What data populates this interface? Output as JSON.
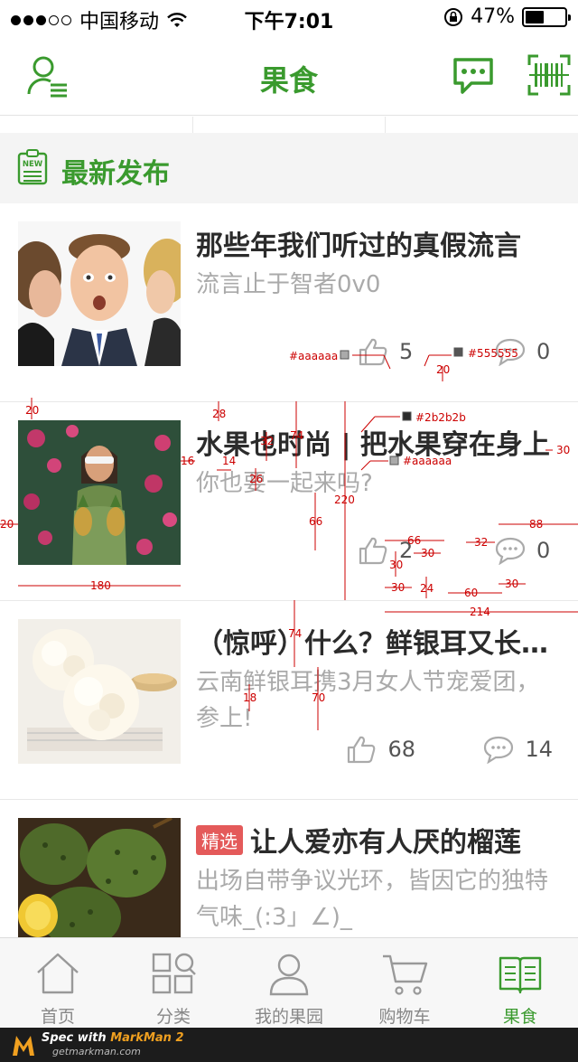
{
  "status_bar": {
    "carrier": "中国移动",
    "time": "下午7:01",
    "battery_text": "47%",
    "battery_level": 0.47
  },
  "nav": {
    "title": "果食",
    "left_icon": "user-list-icon",
    "right_icons": [
      "message-icon",
      "barcode-scan-icon"
    ]
  },
  "section": {
    "icon": "new-clipboard-icon",
    "badge_text": "NEW",
    "title": "最新发布"
  },
  "articles": [
    {
      "title": "那些年我们听过的真假流言",
      "desc": "流言止于智者0v0",
      "likes": "5",
      "comments": "0",
      "image": "man-being-whispered-photo"
    },
    {
      "title": "水果也时尚 | 把水果穿在身上",
      "desc": "你也要一起来吗?",
      "likes": "2",
      "comments": "0",
      "image": "woman-with-pineapples-photo"
    },
    {
      "title": "（惊呼）什么？鲜银耳又长毛了",
      "desc": "云南鲜银耳携3月女人节宠爱团，参上!",
      "likes": "68",
      "comments": "14",
      "image": "white-fungus-photo"
    },
    {
      "badge": "精选",
      "title": "让人爱亦有人厌的榴莲",
      "desc": "出场自带争议光环，皆因它的独特气味_(:3」∠)_",
      "likes": "",
      "comments": "",
      "image": "durian-photo"
    }
  ],
  "spec_annotations": {
    "colors": [
      "#aaaaaa",
      "#555555",
      "#2b2b2b",
      "#aaaaaa"
    ],
    "numbers": [
      "20",
      "20",
      "28",
      "74",
      "16",
      "32",
      "14",
      "26",
      "30",
      "220",
      "66",
      "180",
      "20",
      "66",
      "30",
      "32",
      "88",
      "30",
      "30",
      "24",
      "60",
      "30",
      "214",
      "74",
      "18",
      "70"
    ]
  },
  "tabs": [
    {
      "label": "首页",
      "icon": "home-icon",
      "active": false
    },
    {
      "label": "分类",
      "icon": "category-grid-icon",
      "active": false
    },
    {
      "label": "我的果园",
      "icon": "person-icon",
      "active": false
    },
    {
      "label": "购物车",
      "icon": "cart-icon",
      "active": false
    },
    {
      "label": "果食",
      "icon": "open-book-icon",
      "active": true
    }
  ],
  "markman": {
    "prefix": "Spec with ",
    "brand": "MarkMan 2",
    "site": "getmarkman.com"
  },
  "theme": {
    "accent": "#3a9a2e",
    "badge": "#e45a5a",
    "title_text": "#2b2b2b",
    "desc_text": "#aaaaaa",
    "stat_text": "#555555"
  }
}
